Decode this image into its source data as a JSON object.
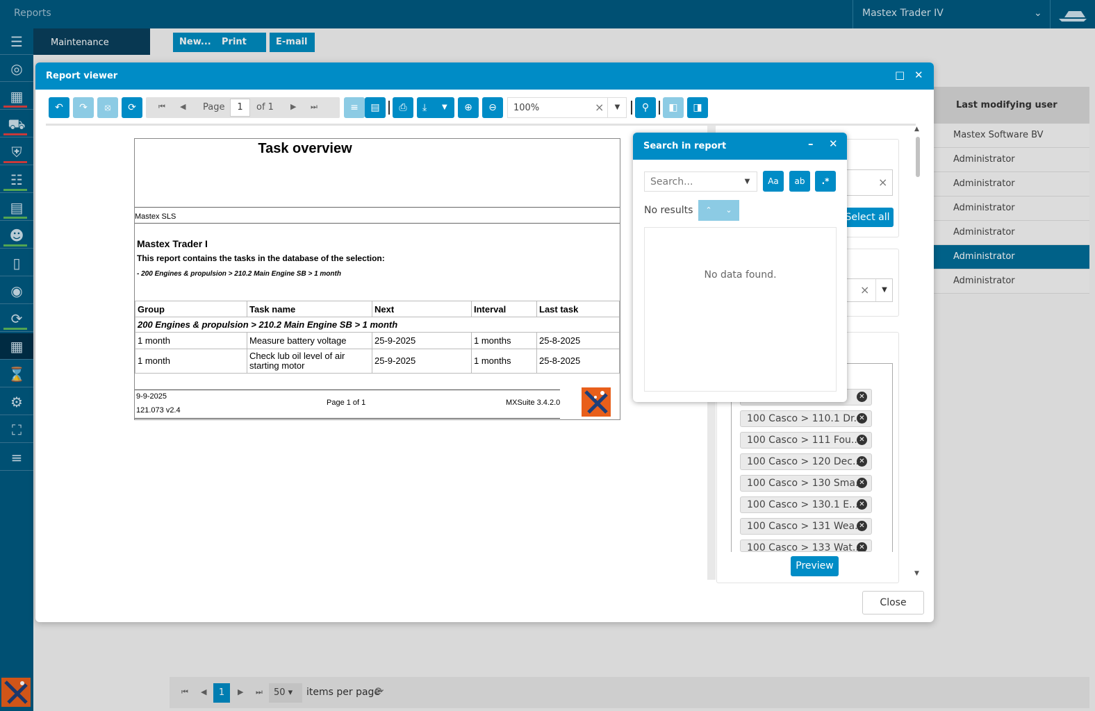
{
  "header": {
    "app_title": "Reports",
    "workspace": "Mastex Trader IV"
  },
  "rail": {
    "items": [
      "list-icon",
      "dashboard-icon",
      "calendar-icon",
      "truck-icon",
      "shield-icon",
      "cart-icon",
      "docs-icon",
      "crew-icon",
      "bottle-icon",
      "globe-icon",
      "sync-icon",
      "planner-icon",
      "hourglass-icon",
      "gear-icon",
      "expand-icon",
      "sliders-icon"
    ]
  },
  "background": {
    "tab": "Maintenance",
    "buttons": {
      "new": "New...",
      "print": "Print",
      "email": "E-mail"
    },
    "grid": {
      "column_header": "Last modifying user",
      "rows": [
        "Mastex Software BV",
        "Administrator",
        "Administrator",
        "Administrator",
        "Administrator",
        "Administrator",
        "Administrator"
      ]
    },
    "pager": {
      "current_page": "1",
      "page_size": "50",
      "items_per_page": "items per page"
    }
  },
  "modal": {
    "title": "Report viewer",
    "toolbar": {
      "page_label": "Page",
      "page_value": "1",
      "page_of": "of 1",
      "zoom": "100%"
    },
    "report": {
      "title": "Task overview",
      "company": "Mastex SLS",
      "heading": "Mastex Trader I",
      "description": "This report contains the tasks in the database of the selection:",
      "selection": "- 200 Engines & propulsion > 210.2 Main Engine SB > 1 month",
      "columns": [
        "Group",
        "Task name",
        "Next",
        "Interval",
        "Last task"
      ],
      "group_row": "200 Engines & propulsion > 210.2 Main Engine SB > 1 month",
      "rows": [
        [
          "1 month",
          "Measure battery voltage",
          "25-9-2025",
          "1 months",
          "25-8-2025"
        ],
        [
          "1 month",
          "Check lub oil level of air starting motor",
          "25-9-2025",
          "1 months",
          "25-8-2025"
        ]
      ],
      "footer": {
        "date": "9-9-2025",
        "version": "121.073 v2.4",
        "page": "Page 1 of 1",
        "suite": "MXSuite 3.4.2.0"
      }
    },
    "filter_panel": {
      "select_all": "Select all",
      "chips": [
        "100 Casco > 110.1 Dr...",
        "100 Casco > 111 Fou...",
        "100 Casco > 120 Dec...",
        "100 Casco > 130 Sma...",
        "100 Casco > 130.1 E...",
        "100 Casco > 131 Wea...",
        "100 Casco > 133 Wat..."
      ],
      "preview": "Preview"
    },
    "close": "Close"
  },
  "search_popup": {
    "title": "Search in report",
    "placeholder": "Search...",
    "match_case": "Aa",
    "whole_word": "ab",
    "regex": ".*",
    "status": "No results",
    "empty": "No data found."
  }
}
